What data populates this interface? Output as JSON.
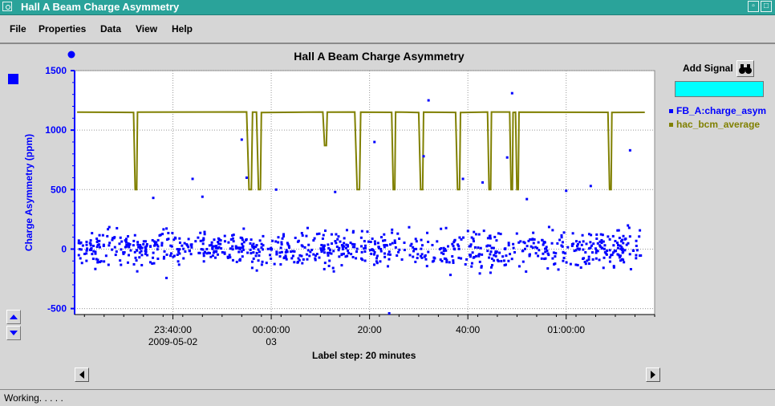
{
  "window": {
    "title": "Hall A Beam Charge Asymmetry"
  },
  "menu": [
    "File",
    "Properties",
    "Data",
    "View",
    "Help"
  ],
  "chart_data": {
    "type": "scatter",
    "title": "Hall A Beam Charge Asymmetry",
    "ylabel": "Charge Asymmetry (ppm)",
    "xlabel": "Label step: 20 minutes",
    "ylim": [
      -550,
      1500
    ],
    "y_ticks": [
      1500,
      1000,
      500,
      0,
      -500
    ],
    "x_ticks": [
      {
        "t": 20,
        "line1": "23:40:00",
        "line2": "2009-05-02"
      },
      {
        "t": 40,
        "line1": "00:00:00",
        "line2": "03"
      },
      {
        "t": 60,
        "line1": "20:00",
        "line2": ""
      },
      {
        "t": 80,
        "line1": "40:00",
        "line2": ""
      },
      {
        "t": 100,
        "line1": "01:00:00",
        "line2": ""
      }
    ],
    "xlim": [
      0,
      118
    ],
    "grid": true,
    "series": [
      {
        "name": "FB_A:charge_asym",
        "color": "#0000ff",
        "kind": "points",
        "count": 900,
        "mean": 0,
        "spread": 130,
        "outliers": [
          [
            16,
            430
          ],
          [
            26,
            440
          ],
          [
            41,
            500
          ],
          [
            72,
            1250
          ],
          [
            71,
            780
          ],
          [
            61,
            900
          ],
          [
            35,
            600
          ],
          [
            34,
            920
          ],
          [
            89,
            1310
          ],
          [
            88,
            770
          ],
          [
            79,
            590
          ],
          [
            83,
            560
          ],
          [
            92,
            420
          ],
          [
            100,
            490
          ],
          [
            105,
            530
          ],
          [
            113,
            830
          ],
          [
            24,
            590
          ],
          [
            53,
            480
          ],
          [
            64,
            -540
          ]
        ]
      },
      {
        "name": "hac_bcm_average",
        "color": "#808000",
        "kind": "line",
        "base": 1150,
        "dips": [
          [
            12.0,
            12.8,
            500
          ],
          [
            35.0,
            36.2,
            500
          ],
          [
            37.0,
            38.0,
            500
          ],
          [
            50.5,
            51.4,
            870
          ],
          [
            57.0,
            58.2,
            500
          ],
          [
            64.5,
            65.3,
            500
          ],
          [
            70.0,
            71.0,
            500
          ],
          [
            77.5,
            78.5,
            500
          ],
          [
            84.0,
            84.8,
            500
          ],
          [
            88.5,
            89.2,
            500
          ],
          [
            89.7,
            90.4,
            500
          ],
          [
            108.5,
            109.3,
            500
          ]
        ]
      }
    ]
  },
  "add_signal": {
    "label": "Add Signal",
    "value": ""
  },
  "scroll": {
    "left": "◀",
    "right": "▶"
  },
  "status": "Working. . . . ."
}
